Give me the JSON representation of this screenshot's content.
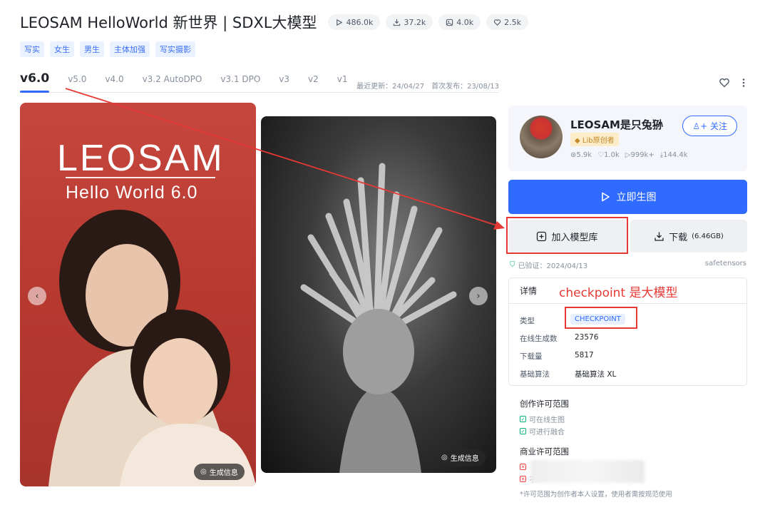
{
  "header": {
    "title": "LEOSAM HelloWorld 新世界 | SDXL大模型",
    "stats": [
      {
        "icon": "play-icon",
        "value": "486.0k"
      },
      {
        "icon": "download-icon",
        "value": "37.2k"
      },
      {
        "icon": "image-icon",
        "value": "4.0k"
      },
      {
        "icon": "heart-icon",
        "value": "2.5k"
      }
    ],
    "tags": [
      "写实",
      "女生",
      "男生",
      "主体加强",
      "写实摄影"
    ]
  },
  "versions": {
    "tabs": [
      "v6.0",
      "v5.0",
      "v4.0",
      "v3.2 AutoDPO",
      "v3.1 DPO",
      "v3",
      "v2",
      "v1"
    ],
    "active": "v6.0",
    "updated": "最近更新：24/04/27",
    "published": "首次发布：23/08/13"
  },
  "gallery": {
    "image1_logo": "LEOSAM",
    "image1_subtitle": "Hello World 6.0",
    "gen_info_label": "生成信息",
    "prev": "‹",
    "next": "›"
  },
  "author": {
    "name": "LEOSAM是只兔狲",
    "badge": "Lib原创者",
    "follow_label": "关注",
    "stats": [
      {
        "icon": "user-icon",
        "value": "5.9k"
      },
      {
        "icon": "like-icon",
        "value": "1.0k"
      },
      {
        "icon": "play-icon",
        "value": "999k+"
      },
      {
        "icon": "download-icon",
        "value": "144.4k"
      }
    ]
  },
  "actions": {
    "generate_label": "立即生图",
    "add_label": "加入模型库",
    "download_label": "下载",
    "download_size": "(6.46GB)",
    "verified": "已验证：2024/04/13",
    "format": "safetensors"
  },
  "details": {
    "header": "详情",
    "annotation": "checkpoint 是大模型",
    "rows": [
      {
        "label": "类型",
        "value": "CHECKPOINT"
      },
      {
        "label": "在线生成数",
        "value": "23576"
      },
      {
        "label": "下载量",
        "value": "5817"
      },
      {
        "label": "基础算法",
        "value": "基础算法 XL"
      }
    ]
  },
  "license": {
    "create_title": "创作许可范围",
    "create_items": [
      "可在线生图",
      "可进行融合"
    ],
    "commercial_title": "商业许可范围",
    "commercial_items": [
      "用的",
      "不"
    ],
    "note": "*许可范围为创作者本人设置，使用者需按规范使用"
  },
  "colors": {
    "accent": "#2f6bff",
    "annotation": "#e53935",
    "ok": "#00b578"
  }
}
